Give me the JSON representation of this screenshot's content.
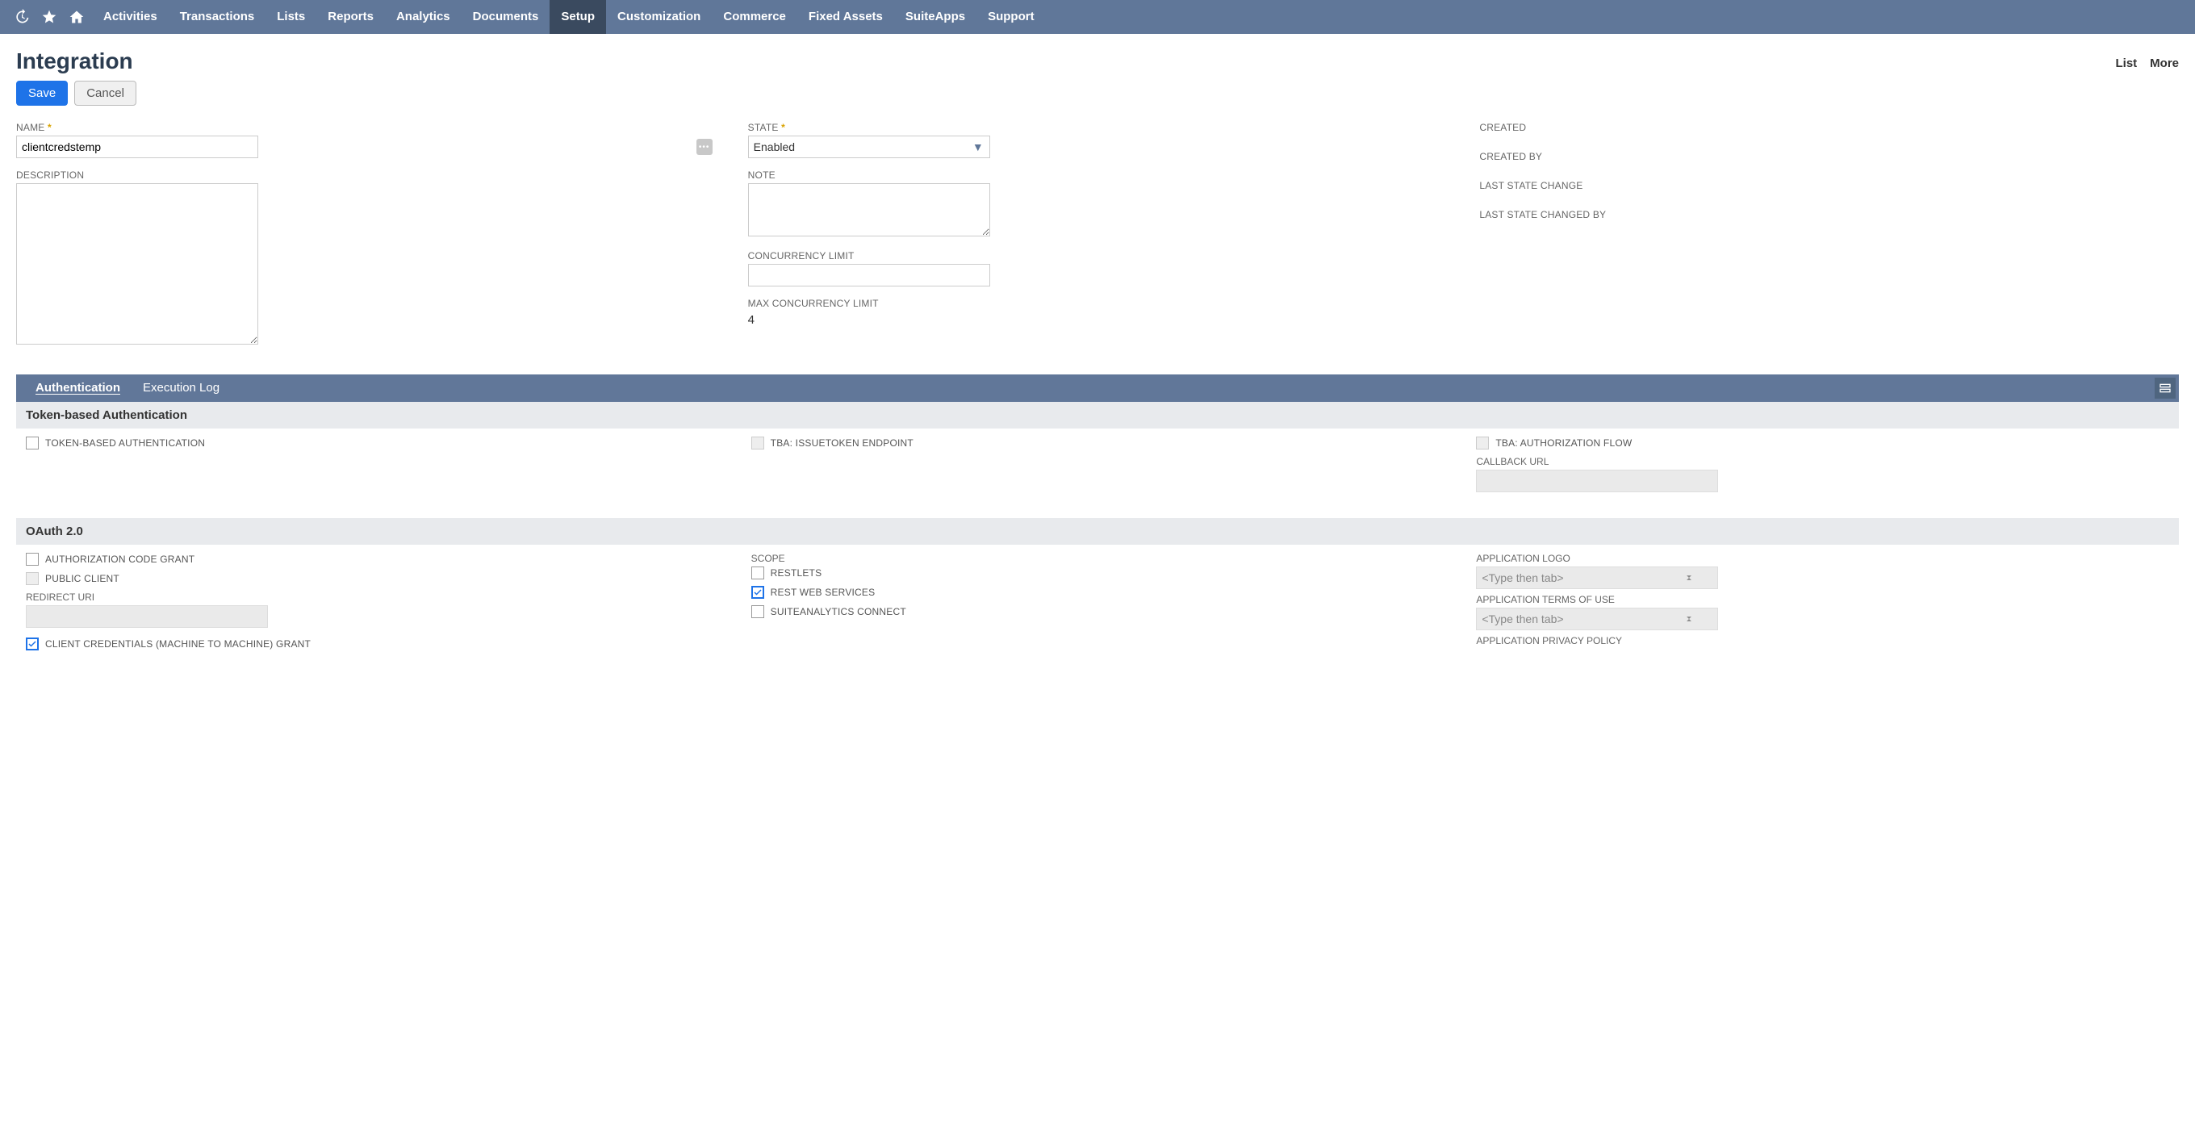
{
  "nav": {
    "items": [
      "Activities",
      "Transactions",
      "Lists",
      "Reports",
      "Analytics",
      "Documents",
      "Setup",
      "Customization",
      "Commerce",
      "Fixed Assets",
      "SuiteApps",
      "Support"
    ],
    "active": "Setup"
  },
  "page": {
    "title": "Integration",
    "header_actions": {
      "list": "List",
      "more": "More"
    },
    "buttons": {
      "save": "Save",
      "cancel": "Cancel"
    }
  },
  "fields": {
    "name_label": "NAME",
    "name_value": "clientcredstemp",
    "description_label": "DESCRIPTION",
    "description_value": "",
    "state_label": "STATE",
    "state_value": "Enabled",
    "note_label": "NOTE",
    "note_value": "",
    "concurrency_limit_label": "CONCURRENCY LIMIT",
    "concurrency_limit_value": "",
    "max_concurrency_limit_label": "MAX CONCURRENCY LIMIT",
    "max_concurrency_limit_value": "4",
    "created_label": "CREATED",
    "created_by_label": "CREATED BY",
    "last_state_change_label": "LAST STATE CHANGE",
    "last_state_changed_by_label": "LAST STATE CHANGED BY"
  },
  "subtabs": {
    "authentication": "Authentication",
    "execution_log": "Execution Log"
  },
  "sections": {
    "tba": {
      "header": "Token-based Authentication",
      "tba_auth": "TOKEN-BASED AUTHENTICATION",
      "tba_issuetoken": "TBA: ISSUETOKEN ENDPOINT",
      "tba_authflow": "TBA: AUTHORIZATION FLOW",
      "callback_url_label": "CALLBACK URL"
    },
    "oauth": {
      "header": "OAuth 2.0",
      "auth_code_grant": "AUTHORIZATION CODE GRANT",
      "public_client": "PUBLIC CLIENT",
      "redirect_uri_label": "REDIRECT URI",
      "client_creds_grant": "CLIENT CREDENTIALS (MACHINE TO MACHINE) GRANT",
      "scope_label": "SCOPE",
      "restlets": "RESTLETS",
      "rest_web_services": "REST WEB SERVICES",
      "suiteanalytics": "SUITEANALYTICS CONNECT",
      "app_logo_label": "APPLICATION LOGO",
      "app_tou_label": "APPLICATION TERMS OF USE",
      "app_privacy_label": "APPLICATION PRIVACY POLICY",
      "typeahead_placeholder": "<Type then tab>"
    }
  }
}
